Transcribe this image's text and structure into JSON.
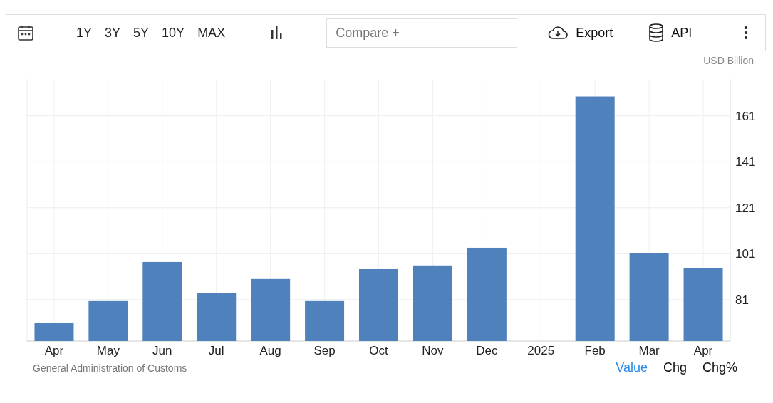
{
  "toolbar": {
    "ranges": [
      {
        "label": "1Y",
        "selected": false
      },
      {
        "label": "3Y",
        "selected": false
      },
      {
        "label": "5Y",
        "selected": false
      },
      {
        "label": "10Y",
        "selected": false
      },
      {
        "label": "MAX",
        "selected": false
      }
    ],
    "compare": {
      "placeholder": "Compare +"
    },
    "actions": [
      {
        "kind": "export",
        "label": "Export"
      },
      {
        "kind": "api",
        "label": "API"
      }
    ]
  },
  "chart": {
    "unit": "USD Billion",
    "chart_data": {
      "type": "bar",
      "categories": [
        "Apr",
        "May",
        "Jun",
        "Jul",
        "Aug",
        "Sep",
        "Oct",
        "Nov",
        "Dec",
        "2025",
        "Feb",
        "Mar",
        "Apr"
      ],
      "grid": true,
      "series": [
        {
          "color": "#4f81bd",
          "values": [
            70.8,
            80.4,
            97.4,
            83.8,
            90.0,
            80.4,
            94.3,
            95.9,
            103.6,
            null,
            169.4,
            101.1,
            94.6
          ]
        }
      ],
      "ylim": [
        63,
        177
      ],
      "yticks": [
        81,
        101,
        121,
        141,
        161
      ]
    }
  },
  "footer": {
    "source": "General Administration of Customs",
    "views": [
      {
        "label": "Value",
        "selected": true
      },
      {
        "label": "Chg",
        "selected": false
      },
      {
        "label": "Chg%",
        "selected": false
      }
    ]
  }
}
